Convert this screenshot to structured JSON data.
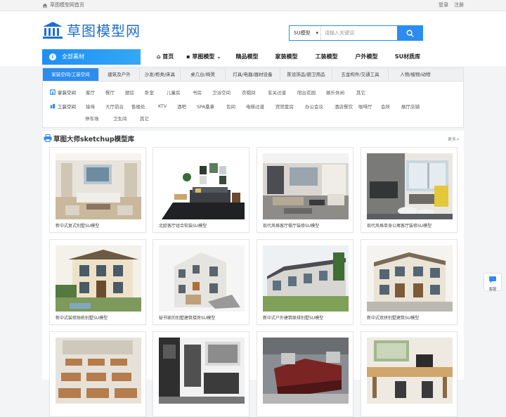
{
  "topbar": {
    "home_text": "草图模型网首页",
    "login": "登录",
    "register": "注册"
  },
  "logo": {
    "text": "草图模型网"
  },
  "search": {
    "select": "SU模型",
    "placeholder": "请输入关键词"
  },
  "nav": {
    "all_label": "全部素材",
    "items": [
      {
        "label": "首页",
        "icon": "home-icon"
      },
      {
        "label": "草图模型",
        "icon": "cube-icon",
        "arrow": "⌄"
      },
      {
        "label": "精品模型"
      },
      {
        "label": "家装模型"
      },
      {
        "label": "工装模型"
      },
      {
        "label": "户外模型"
      },
      {
        "label": "SU材质库"
      }
    ]
  },
  "tabs": [
    "家装空间/工装空间",
    "建筑及户外",
    "沙发/柜类/床具",
    "桌几台/椅凳",
    "灯具/电器/器材设备",
    "陈设饰品/厨卫用品",
    "五金构件/交通工具",
    "人物/植物/动物"
  ],
  "rows": [
    {
      "label": "家装空间",
      "items": [
        "客厅",
        "餐厅",
        "厨房",
        "卧室",
        "儿童房",
        "书房",
        "卫浴空间",
        "衣帽间",
        "玄关过道",
        "阳台花园",
        "娱乐休闲",
        "其它"
      ]
    },
    {
      "label": "工装空间",
      "items": [
        "接待",
        "大厅前台",
        "售楼处",
        "KTV",
        "酒吧",
        "SPA桑拿",
        "包间",
        "电梯过道",
        "宾馆套房",
        "办公会议",
        "酒店餐饮",
        "咖啡厅",
        "会所",
        "展厅店铺"
      ]
    },
    {
      "label": "",
      "items": [
        "停车场",
        "卫生间",
        "其它"
      ]
    }
  ],
  "section": {
    "title": "草图大师sketchup模型库",
    "more": "更多>"
  },
  "cards": [
    {
      "caption": "新中式复式别墅SU模型",
      "theme": "living"
    },
    {
      "caption": "北欧客厅组合软装SU模型",
      "theme": "nordic"
    },
    {
      "caption": "现代风格客厅餐厅装修SU模型",
      "theme": "modern"
    },
    {
      "caption": "现代风格单身公寓客厅装修SU模型",
      "theme": "apartment"
    },
    {
      "caption": "新中式装修独栋别墅SU模型",
      "theme": "villa"
    },
    {
      "caption": "秘书家的别墅建筑楼房SU模型",
      "theme": "building"
    },
    {
      "caption": "新中式户外建筑联排别墅SU模型",
      "theme": "townhouse"
    },
    {
      "caption": "新中式双拼别墅建筑SU模型",
      "theme": "duplex"
    },
    {
      "caption": "",
      "theme": "classroom"
    },
    {
      "caption": "",
      "theme": "office"
    },
    {
      "caption": "",
      "theme": "reception"
    },
    {
      "caption": "",
      "theme": "study"
    }
  ],
  "side": {
    "label": "客服"
  },
  "colors": {
    "primary": "#2d8cf0",
    "logo": "#1c6fd1"
  }
}
